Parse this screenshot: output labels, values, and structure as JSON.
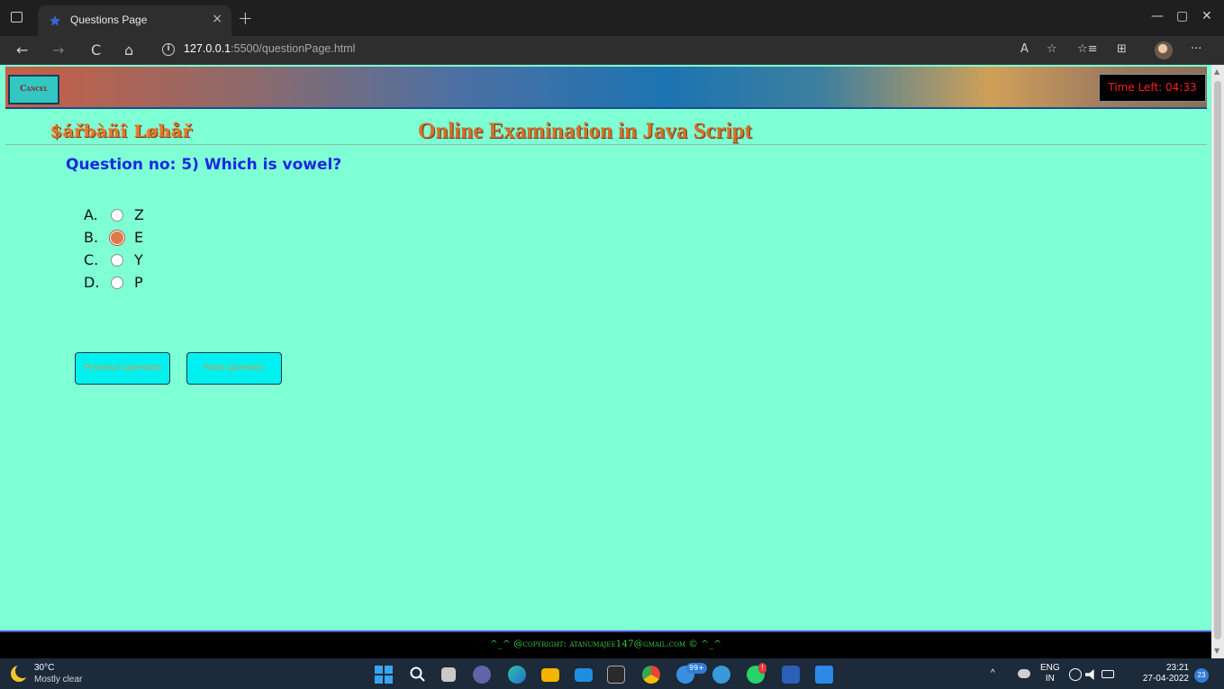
{
  "browser": {
    "tab_title": "Questions Page",
    "tab_close": "×",
    "new_tab": "+",
    "url_host": "127.0.0.1",
    "url_path": ":5500/questionPage.html",
    "minimize": "—",
    "restore": "▢",
    "close": "✕",
    "back": "←",
    "forward": "→",
    "refresh": "C",
    "home": "⌂",
    "read_aloud": "A",
    "favorite": "☆",
    "favorites": "☆≡",
    "collections": "⊞",
    "more": "···"
  },
  "page": {
    "cancel_label": "Cancel",
    "timer": "Time Left: 04:33",
    "brand": "$ářbàñî Løhåř",
    "title": "Online Examination in Java Script",
    "question": "Question no: 5) Which is vowel?",
    "options": [
      {
        "letter": "A.",
        "text": "Z",
        "checked": false
      },
      {
        "letter": "B.",
        "text": "E",
        "checked": true
      },
      {
        "letter": "C.",
        "text": "Y",
        "checked": false
      },
      {
        "letter": "D.",
        "text": "P",
        "checked": false
      }
    ],
    "prev_label": "Previous Question",
    "next_label": "Next Question",
    "footer": "^_^ @copyright: atanumajee147@gmail.com © ^_^"
  },
  "taskbar": {
    "temp": "30°C",
    "condition": "Mostly clear",
    "badge_count": "99+",
    "badge_alert": "!",
    "lang_top": "ENG",
    "lang_bottom": "IN",
    "time": "23:21",
    "date": "27-04-2022",
    "notif_count": "23",
    "chevron": "^"
  },
  "colors": {
    "page_bg": "#7fffd4",
    "question": "#1a28e0",
    "title": "#d2712a",
    "timer_text": "#ff1f1f",
    "footer_text": "#37c43c"
  }
}
